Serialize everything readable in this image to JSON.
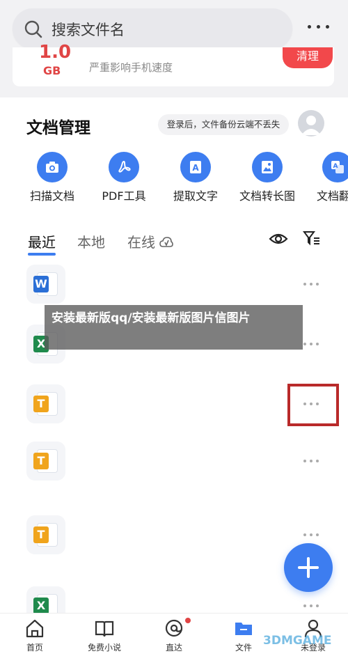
{
  "search": {
    "placeholder": "搜索文件名"
  },
  "storage": {
    "big_value": "1.0",
    "unit": "GB",
    "message": "严重影响手机速度",
    "clean_label": "清理"
  },
  "doc_section": {
    "title": "文档管理",
    "login_hint": "登录后，文件备份云端不丢失"
  },
  "tools": [
    {
      "label": "扫描文档",
      "icon": "camera-icon"
    },
    {
      "label": "PDF工具",
      "icon": "pdf-icon"
    },
    {
      "label": "提取文字",
      "icon": "text-extract-icon"
    },
    {
      "label": "文档转长图",
      "icon": "image-icon"
    },
    {
      "label": "文档翻",
      "icon": "translate-icon"
    }
  ],
  "tabs": {
    "recent": "最近",
    "local": "本地",
    "online": "在线"
  },
  "files": [
    {
      "type": "W",
      "color": "#2b6fd6"
    },
    {
      "type": "X",
      "color": "#1f8a4c"
    },
    {
      "type": "T",
      "color": "#f0a41c"
    },
    {
      "type": "T",
      "color": "#f0a41c"
    },
    {
      "type": "T",
      "color": "#f0a41c"
    },
    {
      "type": "X",
      "color": "#1f8a4c"
    }
  ],
  "overlay": {
    "text": "安装最新版qq/安装最新版图片信图片"
  },
  "bottom_nav": [
    {
      "label": "首页",
      "icon": "home-icon"
    },
    {
      "label": "免费小说",
      "icon": "book-icon"
    },
    {
      "label": "直达",
      "icon": "direct-icon"
    },
    {
      "label": "文件",
      "icon": "folder-icon"
    },
    {
      "label": "未登录",
      "icon": "user-icon"
    }
  ],
  "watermark": "3DMGAME",
  "colors": {
    "accent": "#3d7df0",
    "alert": "#e04545",
    "highlight_frame": "#b92a2a"
  }
}
